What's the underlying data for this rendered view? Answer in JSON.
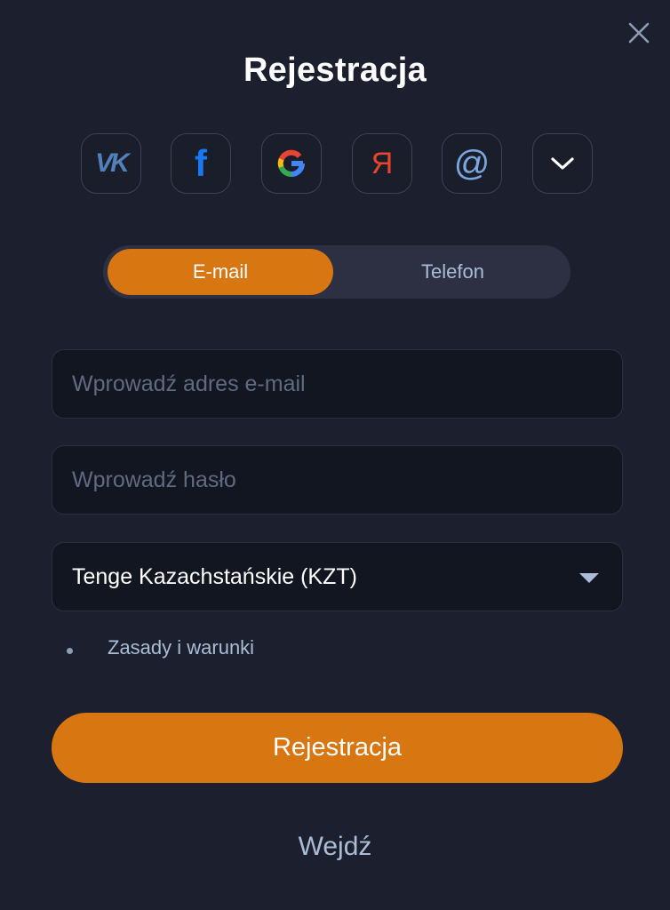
{
  "title": "Rejestracja",
  "social": [
    {
      "name": "vk",
      "glyph": "VK",
      "color": "#5181b8"
    },
    {
      "name": "facebook",
      "glyph": "f",
      "color": "#1877f2"
    },
    {
      "name": "google",
      "glyph": "G"
    },
    {
      "name": "yandex",
      "glyph": "Я",
      "color": "#e8452d"
    },
    {
      "name": "mail",
      "glyph": "@",
      "color": "#7aa7df"
    },
    {
      "name": "more",
      "glyph": "chevron-down"
    }
  ],
  "tabs": {
    "email": "E-mail",
    "phone": "Telefon",
    "active": "email"
  },
  "fields": {
    "email_placeholder": "Wprowadź adres e-mail",
    "password_placeholder": "Wprowadź hasło",
    "currency": "Tenge Kazachstańskie (KZT)"
  },
  "terms": "Zasady i warunki",
  "submit": "Rejestracja",
  "login": "Wejdź",
  "colors": {
    "background": "#1c1f2e",
    "accent": "#d87612",
    "muted_text": "#a9bdd6"
  }
}
